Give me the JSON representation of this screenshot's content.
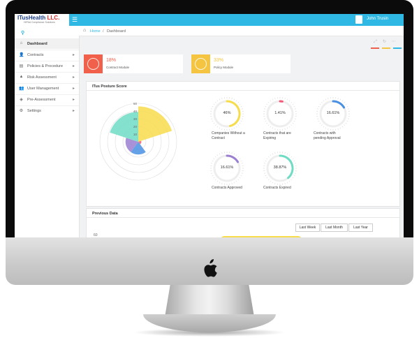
{
  "app": {
    "logo_main": "ITusHealth",
    "logo_suffix": " LLC.",
    "logo_sub": "HIPAA Compliance Solutions",
    "user_name": "John Trusin"
  },
  "sidebar": {
    "items": [
      {
        "label": "Dashboard",
        "icon": "home-icon",
        "glyph": "⌂",
        "active": true,
        "arrow": ""
      },
      {
        "label": "Contracts",
        "icon": "user-icon",
        "glyph": "👤",
        "active": false,
        "arrow": "▸"
      },
      {
        "label": "Policies & Procedure",
        "icon": "book-icon",
        "glyph": "▤",
        "active": false,
        "arrow": "▸"
      },
      {
        "label": "Risk Assessment",
        "icon": "warning-icon",
        "glyph": "▲",
        "active": false,
        "arrow": "▸"
      },
      {
        "label": "User Management",
        "icon": "users-icon",
        "glyph": "👥",
        "active": false,
        "arrow": "▸"
      },
      {
        "label": "Pre-Assessment",
        "icon": "shield-icon",
        "glyph": "◈",
        "active": false,
        "arrow": "▸"
      },
      {
        "label": "Settings",
        "icon": "gear-icon",
        "glyph": "⚙",
        "active": false,
        "arrow": "▸"
      }
    ]
  },
  "breadcrumb": {
    "home": "Home",
    "sep": "/",
    "current": "Dashboard"
  },
  "stats": [
    {
      "pct": "18%",
      "name": "Contract Module",
      "color": "#f0604a"
    },
    {
      "pct": "33%",
      "name": "Policy Module",
      "color": "#f5c542"
    }
  ],
  "posture": {
    "title": "ITus Posture Score",
    "polar_ticks": [
      "50",
      "40",
      "30",
      "20",
      "10"
    ],
    "gauges": [
      {
        "value": "46%",
        "fraction": 0.46,
        "color": "#f7dc4b",
        "label": "Companies Without a Contract"
      },
      {
        "value": "1.41%",
        "fraction": 0.0141,
        "color": "#f25a78",
        "label": "Contracts that are Expiring"
      },
      {
        "value": "16.61%",
        "fraction": 0.1661,
        "color": "#4a90e2",
        "label": "Contracts with pending Approval"
      },
      {
        "value": "16.61%",
        "fraction": 0.1661,
        "color": "#9b7fd1",
        "label": "Contracts Approved"
      },
      {
        "value": "38.87%",
        "fraction": 0.3887,
        "color": "#6fdcc4",
        "label": "Contracts Expired"
      }
    ]
  },
  "previous": {
    "title": "Previous Data",
    "buttons": [
      "Last Week",
      "Last Month",
      "Last Year"
    ],
    "y_tick": "60"
  }
}
